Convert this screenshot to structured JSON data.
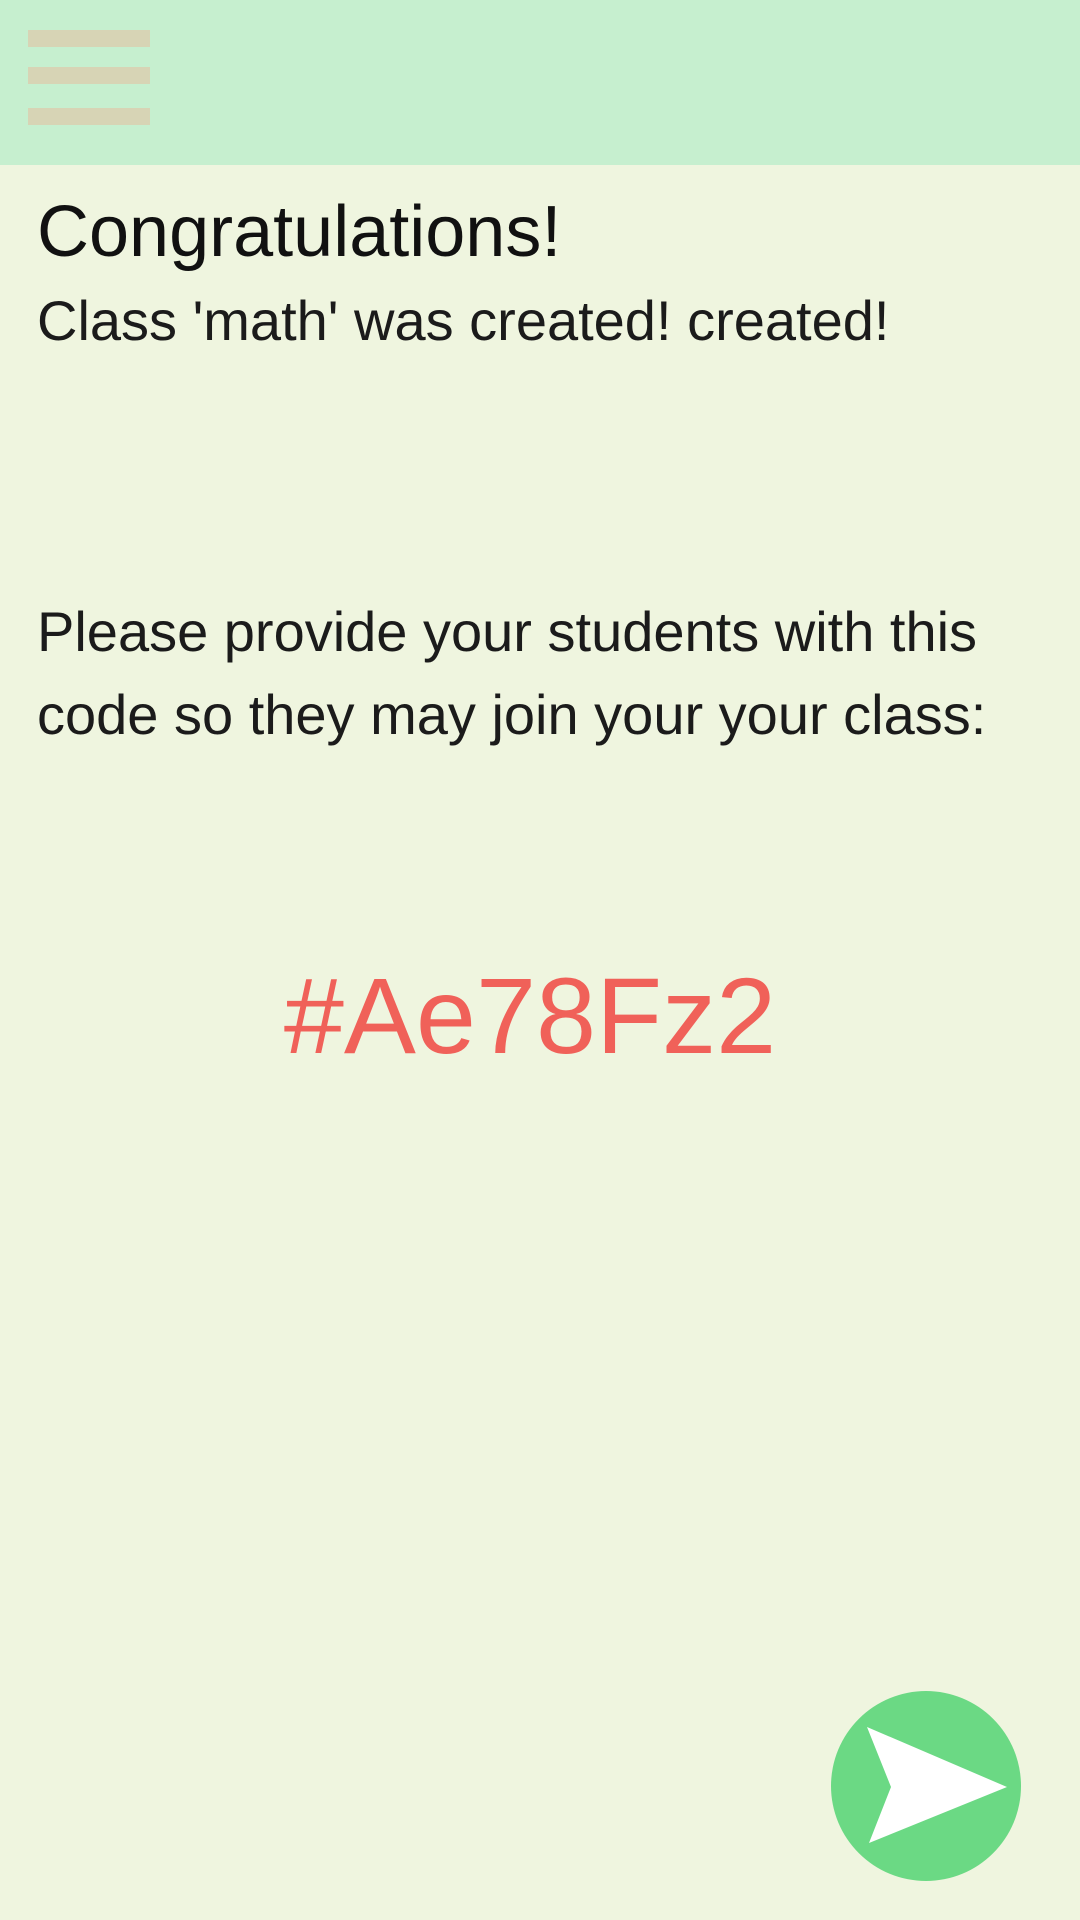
{
  "header": {
    "menu_icon": "hamburger-menu-icon",
    "background_color": "#c6efcf",
    "menu_icon_color": "#d7d4b5"
  },
  "main": {
    "title": "Congratulations!",
    "subtitle": "Class 'math' was created! created!",
    "instructions": "Please provide your students with this code so they may join your your class:",
    "class_code": "#Ae78Fz2",
    "code_color": "#f06159",
    "background_color": "#eff5df"
  },
  "fab": {
    "icon": "send-icon",
    "color": "#6bd984"
  }
}
